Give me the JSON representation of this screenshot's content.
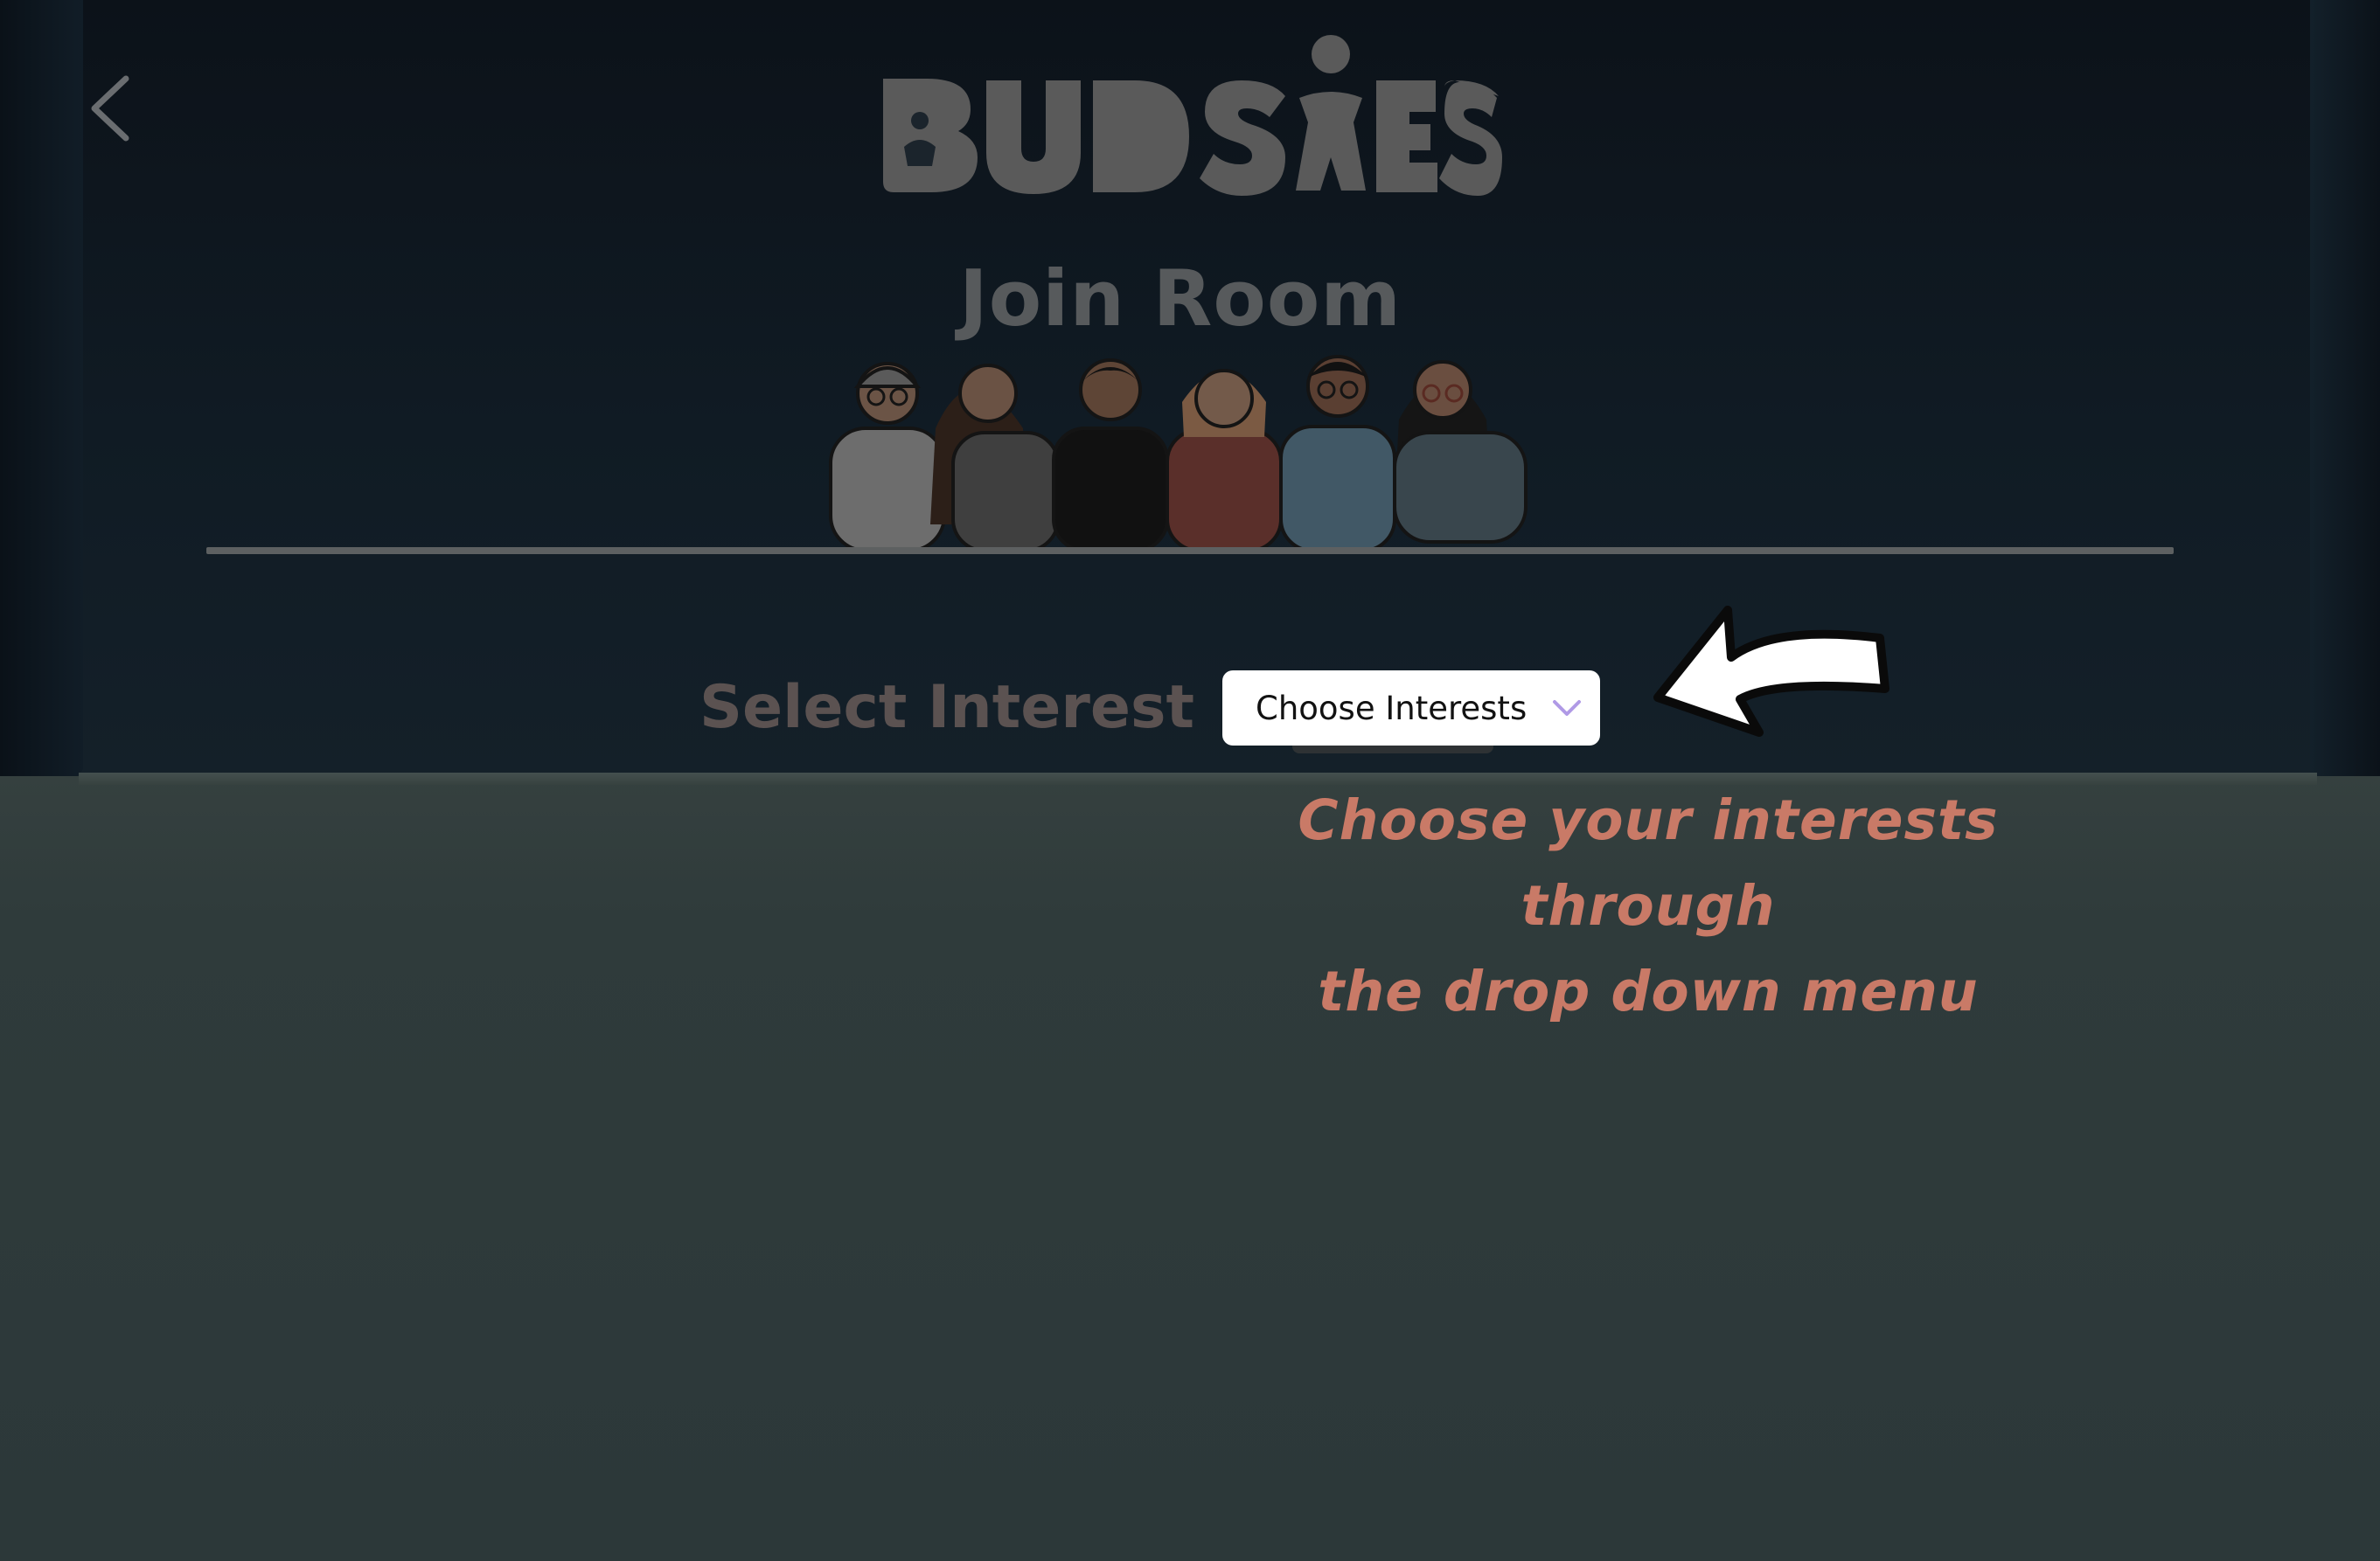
{
  "header": {
    "back_icon": "chevron-left-icon",
    "logo_text": "BUDSIES",
    "title": "Join Room"
  },
  "form": {
    "select_label": "Select Interest",
    "dropdown": {
      "selected": "Choose Interests",
      "icon": "chevron-down-icon"
    }
  },
  "annotation": {
    "line1": "Choose your interests through",
    "line2": "the drop down menu",
    "arrow_icon": "curved-arrow-left-icon"
  },
  "colors": {
    "wall": "#101b24",
    "floor": "#2d3a3b",
    "logo": "#5a5a5a",
    "title": "#575a5c",
    "select_label": "#5b5251",
    "instruction": "#c97a67",
    "chevron_accent": "#b09ae6"
  }
}
